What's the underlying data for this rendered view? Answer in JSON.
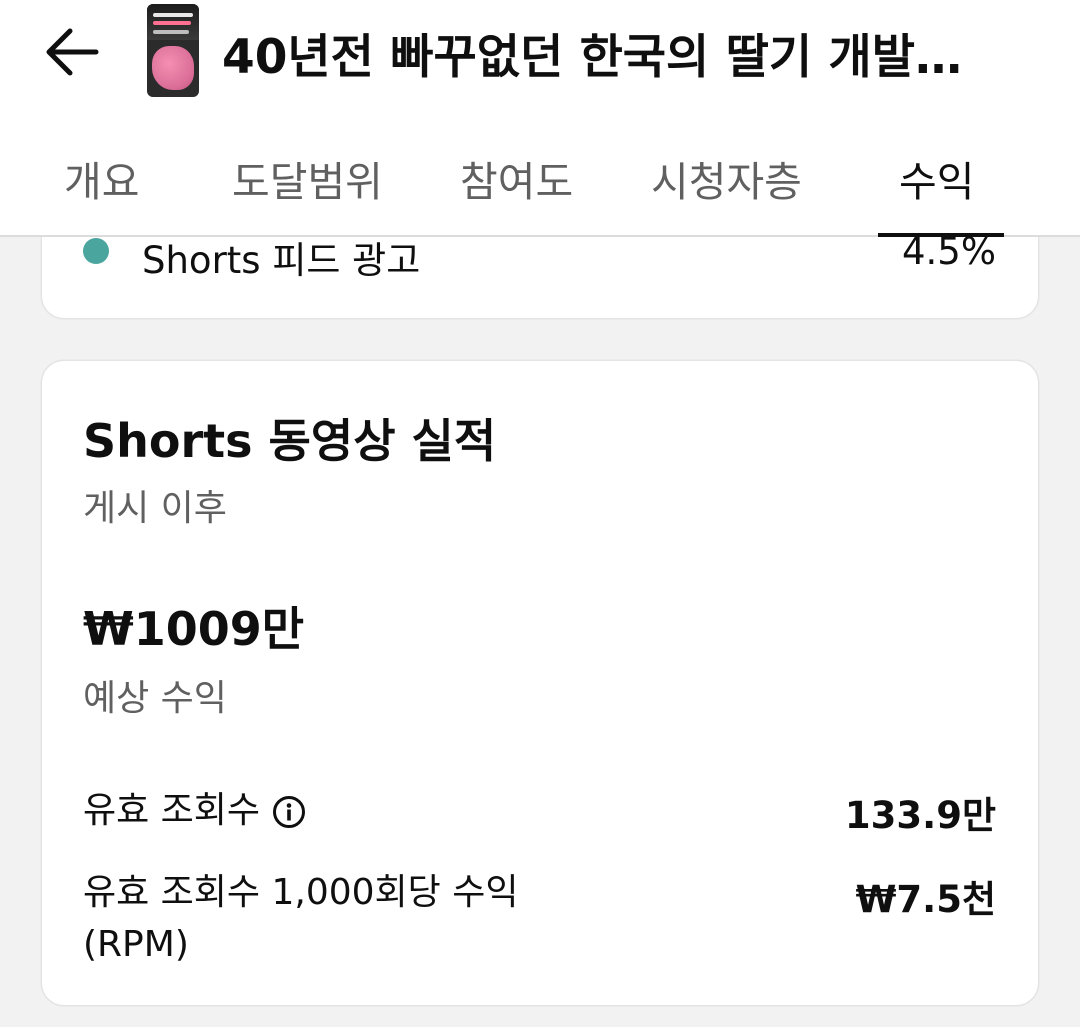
{
  "header": {
    "video_title": "40년전 빠꾸없던 한국의 딸기 개발…"
  },
  "tabs": [
    {
      "label": "개요"
    },
    {
      "label": "도달범위"
    },
    {
      "label": "참여도"
    },
    {
      "label": "시청자층"
    },
    {
      "label": "수익",
      "active": true
    }
  ],
  "partial_card": {
    "legend_label": "Shorts 피드 광고",
    "legend_value": "4.5%",
    "legend_color": "#4aa59e"
  },
  "shorts_performance": {
    "title": "Shorts 동영상 실적",
    "subtitle": "게시 이후",
    "revenue_amount": "₩1009만",
    "revenue_label": "예상 수익",
    "metrics": [
      {
        "label": "유효 조회수",
        "value": "133.9만",
        "icon": "info-icon"
      },
      {
        "label": "유효 조회수 1,000회당 수익(RPM)",
        "value": "₩7.5천"
      }
    ]
  }
}
